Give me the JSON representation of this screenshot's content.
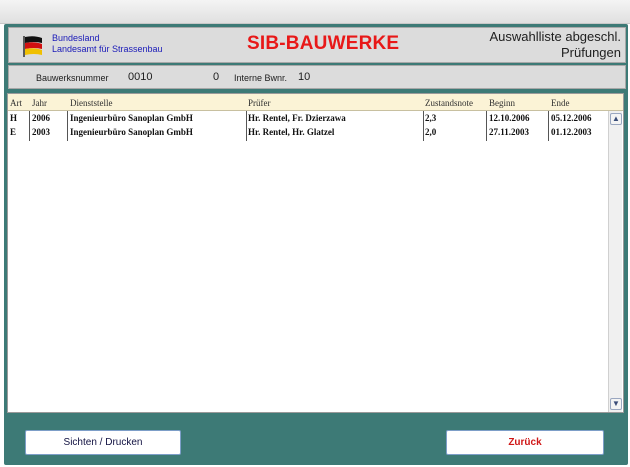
{
  "header": {
    "org_line1": "Bundesland",
    "org_line2": "Landesamt für Strassenbau",
    "app_title": "SIB-BAUWERKE",
    "screen_title_line1": "Auswahlliste abgeschl.",
    "screen_title_line2": "Prüfungen"
  },
  "info": {
    "bauwerk_label": "Bauwerksnummer",
    "bauwerk_value": "0010",
    "extra_value": "0",
    "interne_label": "Interne Bwnr.",
    "interne_value": "10"
  },
  "table": {
    "columns": [
      "Art",
      "Jahr",
      "Dienststelle",
      "Prüfer",
      "Zustandsnote",
      "Beginn",
      "Ende"
    ],
    "rows": [
      {
        "art": "H",
        "jahr": "2006",
        "dienststelle": "Ingenieurbüro Sanoplan GmbH",
        "pruefer": "Hr. Rentel, Fr. Dzierzawa",
        "zustandsnote": "2,3",
        "beginn": "12.10.2006",
        "ende": "05.12.2006"
      },
      {
        "art": "E",
        "jahr": "2003",
        "dienststelle": "Ingenieurbüro Sanoplan GmbH",
        "pruefer": "Hr. Rentel, Hr. Glatzel",
        "zustandsnote": "2,0",
        "beginn": "27.11.2003",
        "ende": "01.12.2003"
      }
    ]
  },
  "buttons": {
    "view_print": "Sichten / Drucken",
    "back": "Zurück"
  },
  "icons": {
    "flag": "flag-icon",
    "scroll_up": "scroll-up-icon",
    "scroll_down": "scroll-down-icon"
  },
  "colors": {
    "frame": "#3d7a76",
    "app_title": "#e81818",
    "org_text": "#1a1ab8",
    "table_header": "#fbf3d6",
    "back_button_text": "#d01818"
  }
}
